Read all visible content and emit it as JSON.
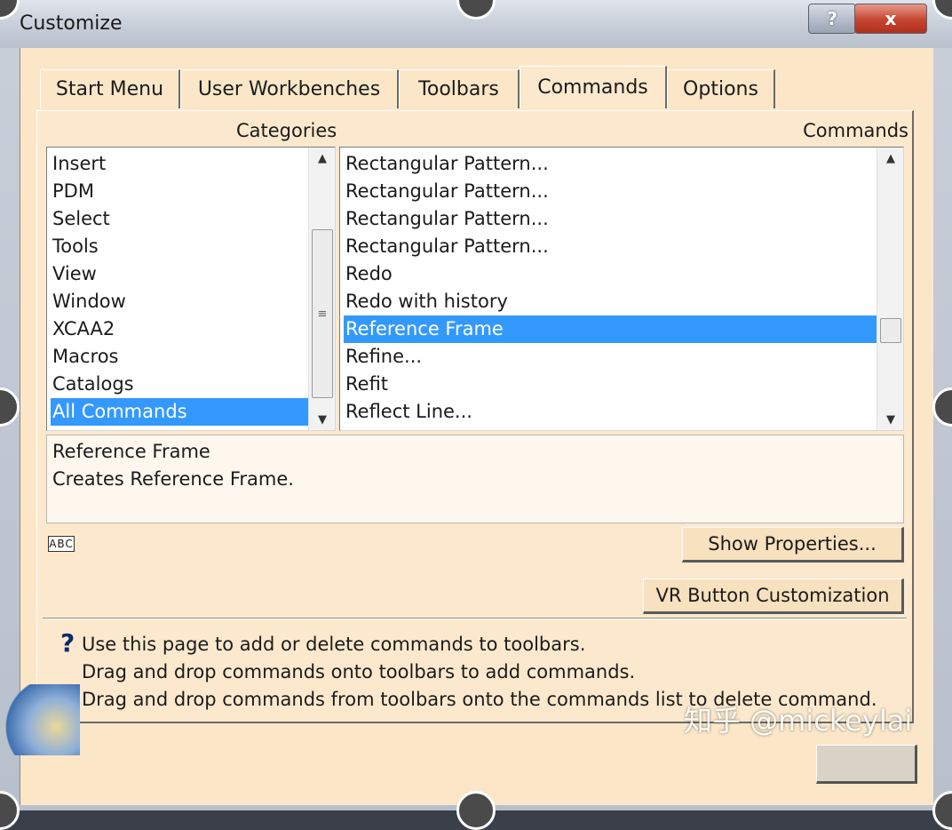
{
  "window": {
    "title": "Customize",
    "help_glyph": "?",
    "close_glyph": "x"
  },
  "tabs": [
    {
      "label": "Start Menu"
    },
    {
      "label": "User Workbenches"
    },
    {
      "label": "Toolbars"
    },
    {
      "label": "Commands"
    },
    {
      "label": "Options"
    }
  ],
  "active_tab": "Commands",
  "categories": {
    "header": "Categories",
    "items": [
      "Insert",
      "PDM",
      "Select",
      "Tools",
      "View",
      "Window",
      "XCAA2",
      "Macros",
      "Catalogs",
      "All Commands"
    ],
    "selected": "All Commands"
  },
  "commands": {
    "header": "Commands",
    "items": [
      "Rectangular Pattern...",
      "Rectangular Pattern...",
      "Rectangular Pattern...",
      "Rectangular Pattern...",
      "Redo",
      "Redo with history",
      "Reference Frame",
      "Refine...",
      "Refit",
      "Reflect Line..."
    ],
    "selected": "Reference Frame"
  },
  "description": {
    "name": "Reference Frame",
    "text": "Creates Reference Frame."
  },
  "abc_icon_label": "ABC",
  "buttons": {
    "show_properties": "Show Properties...",
    "vr_customization": "VR Button Customization"
  },
  "help": {
    "glyph": "?",
    "lines": [
      "Use this page to add or delete commands to toolbars.",
      "Drag and drop commands onto toolbars to add commands.",
      "Drag and drop commands from toolbars onto the commands list to delete command."
    ]
  },
  "watermark": "知乎 @mickeylai",
  "colors": {
    "dialog_bg": "#fbe7c8",
    "selection": "#3399ff",
    "close_button": "#c4442f"
  },
  "icons": {
    "scroll_up": "triangle-up-icon",
    "scroll_down": "triangle-down-icon",
    "abc": "abc-text-icon",
    "help": "question-mark-icon"
  }
}
